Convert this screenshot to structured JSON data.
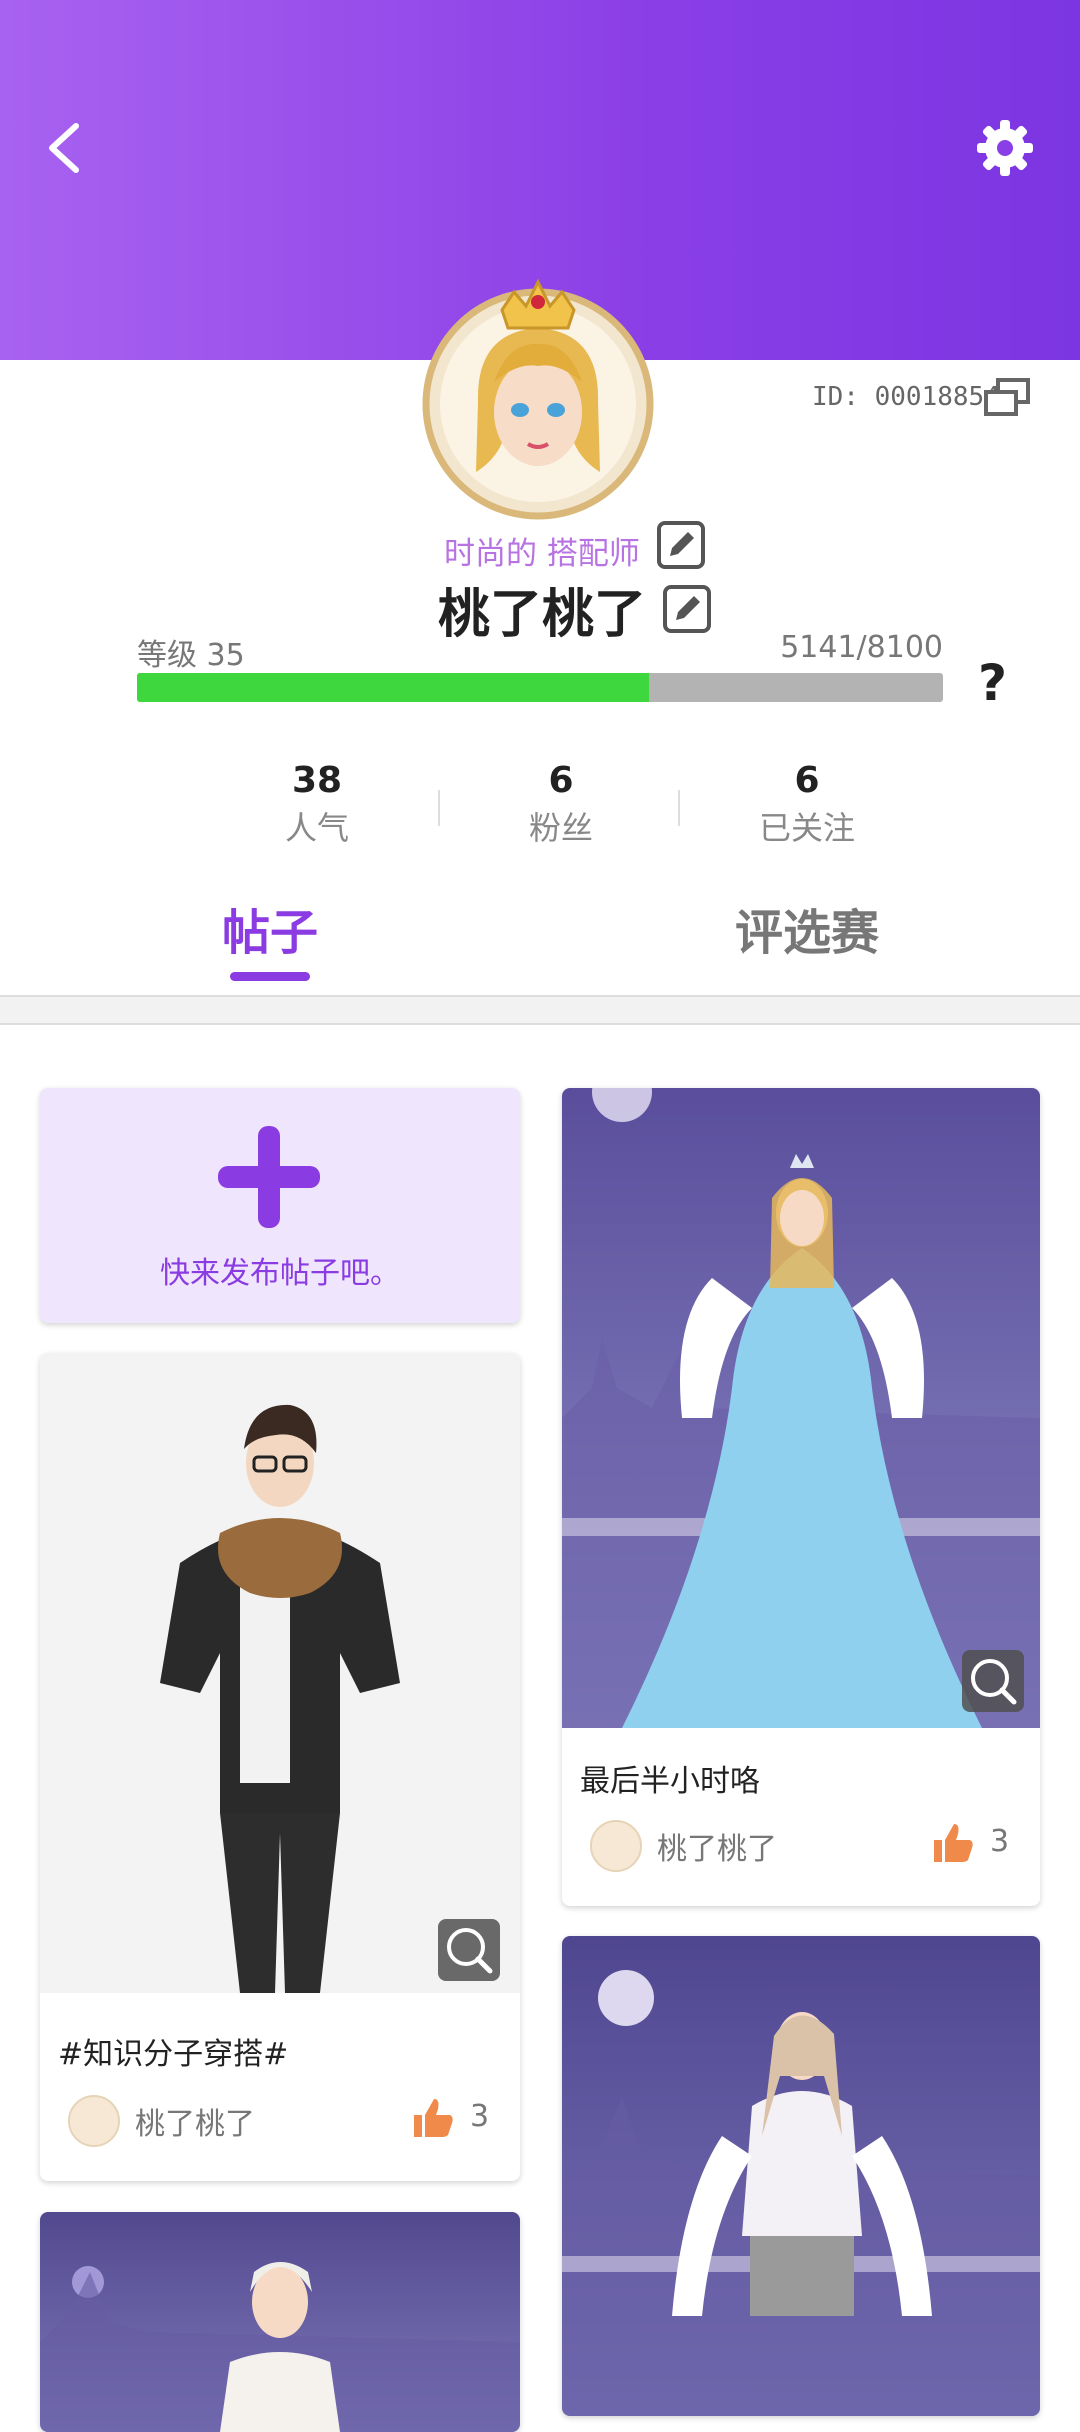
{
  "profile": {
    "id_label": "ID: 00018854",
    "title": "时尚的 搭配师",
    "name": "桃了桃了",
    "level_label": "等级 35",
    "xp_label": "5141/8100",
    "xp_fraction": 0.635,
    "help": "?"
  },
  "stats": [
    {
      "value": "38",
      "label": "人气"
    },
    {
      "value": "6",
      "label": "粉丝"
    },
    {
      "value": "6",
      "label": "已关注"
    }
  ],
  "tabs": [
    {
      "label": "帖子",
      "active": true
    },
    {
      "label": "评选赛",
      "active": false
    }
  ],
  "create_post": {
    "label": "快来发布帖子吧。"
  },
  "posts": [
    {
      "title": "最后半小时咯",
      "author": "桃了桃了",
      "likes": "3"
    },
    {
      "title": "#知识分子穿搭#",
      "author": "桃了桃了",
      "likes": "3"
    }
  ],
  "colors": {
    "accent": "#8a3be2",
    "progress": "#3ed83e",
    "like": "#f08a4b"
  }
}
